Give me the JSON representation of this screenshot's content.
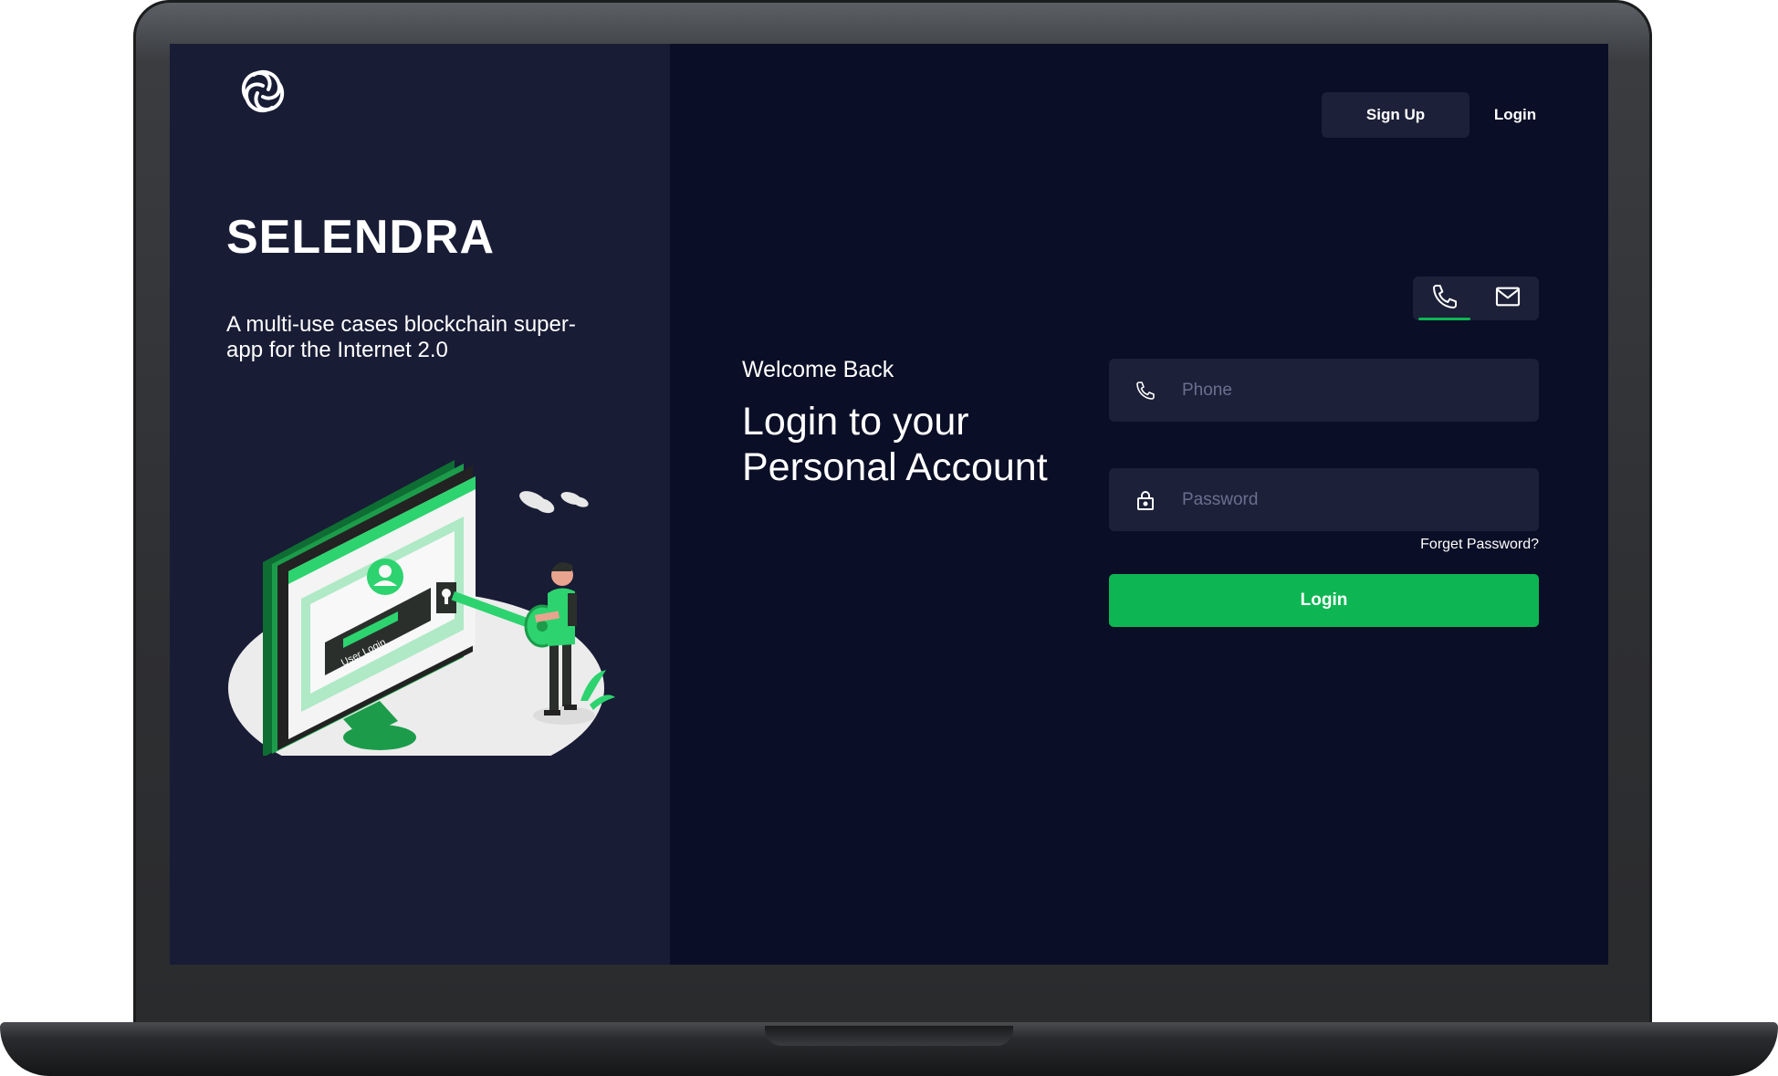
{
  "brand": {
    "title": "SELENDRA",
    "tagline": "A multi-use cases blockchain super-app for the Internet 2.0",
    "logo_icon": "selendra-logo-icon",
    "illustration_label": "User Login"
  },
  "nav": {
    "signup_label": "Sign Up",
    "login_label": "Login"
  },
  "auth": {
    "welcome": "Welcome Back",
    "heading": "Login to your Personal Account",
    "method_tabs": [
      {
        "icon": "phone-icon",
        "active": true
      },
      {
        "icon": "mail-icon",
        "active": false
      }
    ],
    "phone": {
      "placeholder": "Phone",
      "value": "",
      "icon": "phone-icon"
    },
    "password": {
      "placeholder": "Password",
      "value": "",
      "icon": "lock-icon"
    },
    "forgot_label": "Forget Password?",
    "submit_label": "Login"
  },
  "colors": {
    "accent": "#0db652",
    "screen_bg": "#0a0e26",
    "panel_bg": "#181c35",
    "input_bg": "#1c2038"
  }
}
